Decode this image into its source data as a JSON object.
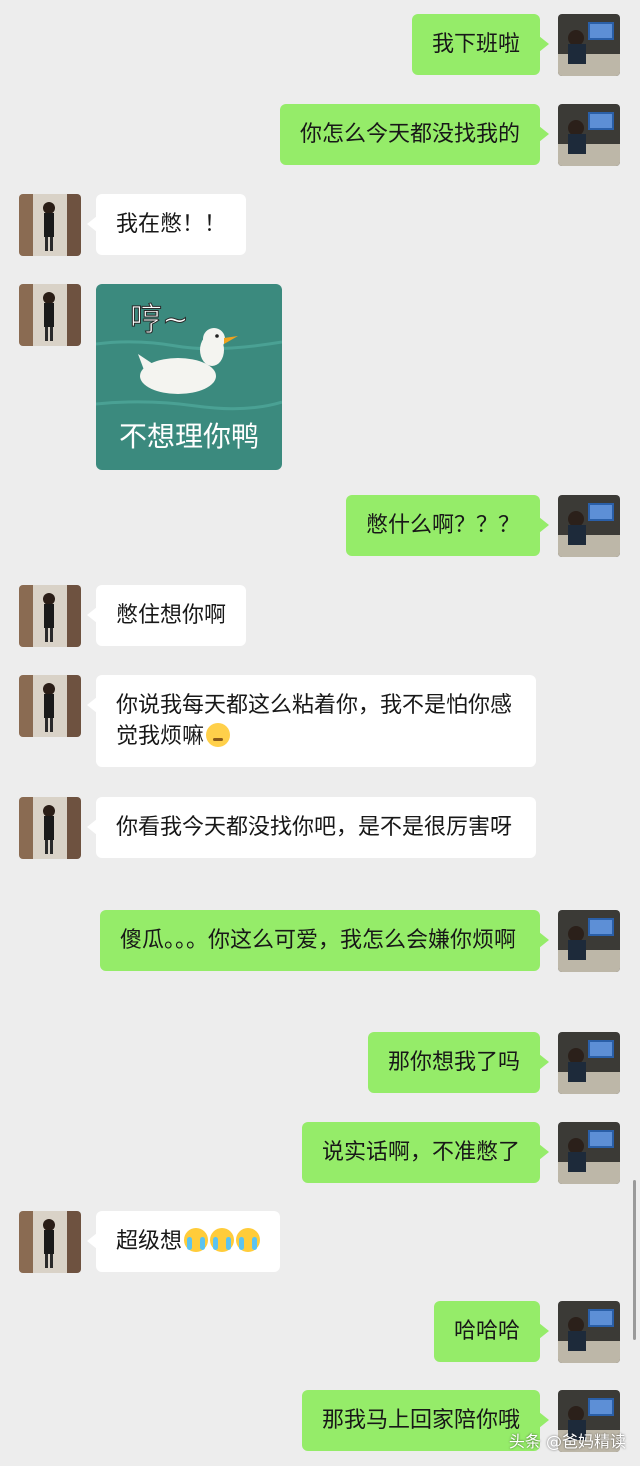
{
  "messages": [
    {
      "side": "right",
      "text": "我下班啦"
    },
    {
      "side": "right",
      "text": "你怎么今天都没找我的"
    },
    {
      "side": "left",
      "text": "我在憋！！"
    },
    {
      "side": "left",
      "type": "sticker",
      "sticker_top": "哼~",
      "sticker_bottom": "不想理你鸭"
    },
    {
      "side": "right",
      "text": "憋什么啊？？？"
    },
    {
      "side": "left",
      "text": "憋住想你啊"
    },
    {
      "side": "left",
      "text": "你说我每天都这么粘着你，我不是怕你感觉我烦嘛",
      "emoji": "pensive-face"
    },
    {
      "side": "left",
      "text": "你看我今天都没找你吧，是不是很厉害呀"
    },
    {
      "side": "right",
      "text": "傻瓜。。。你这么可爱，我怎么会嫌你烦啊"
    },
    {
      "side": "right",
      "text": "那你想我了吗"
    },
    {
      "side": "right",
      "text": "说实话啊，不准憋了"
    },
    {
      "side": "left",
      "text": "超级想",
      "emoji": "loudly-crying-face x3"
    },
    {
      "side": "right",
      "text": "哈哈哈"
    },
    {
      "side": "right",
      "text": "那我马上回家陪你哦"
    }
  ],
  "watermark": "头条 @爸妈精读",
  "colors": {
    "background": "#ededed",
    "bubble_self": "#95ec69",
    "bubble_other": "#ffffff"
  }
}
